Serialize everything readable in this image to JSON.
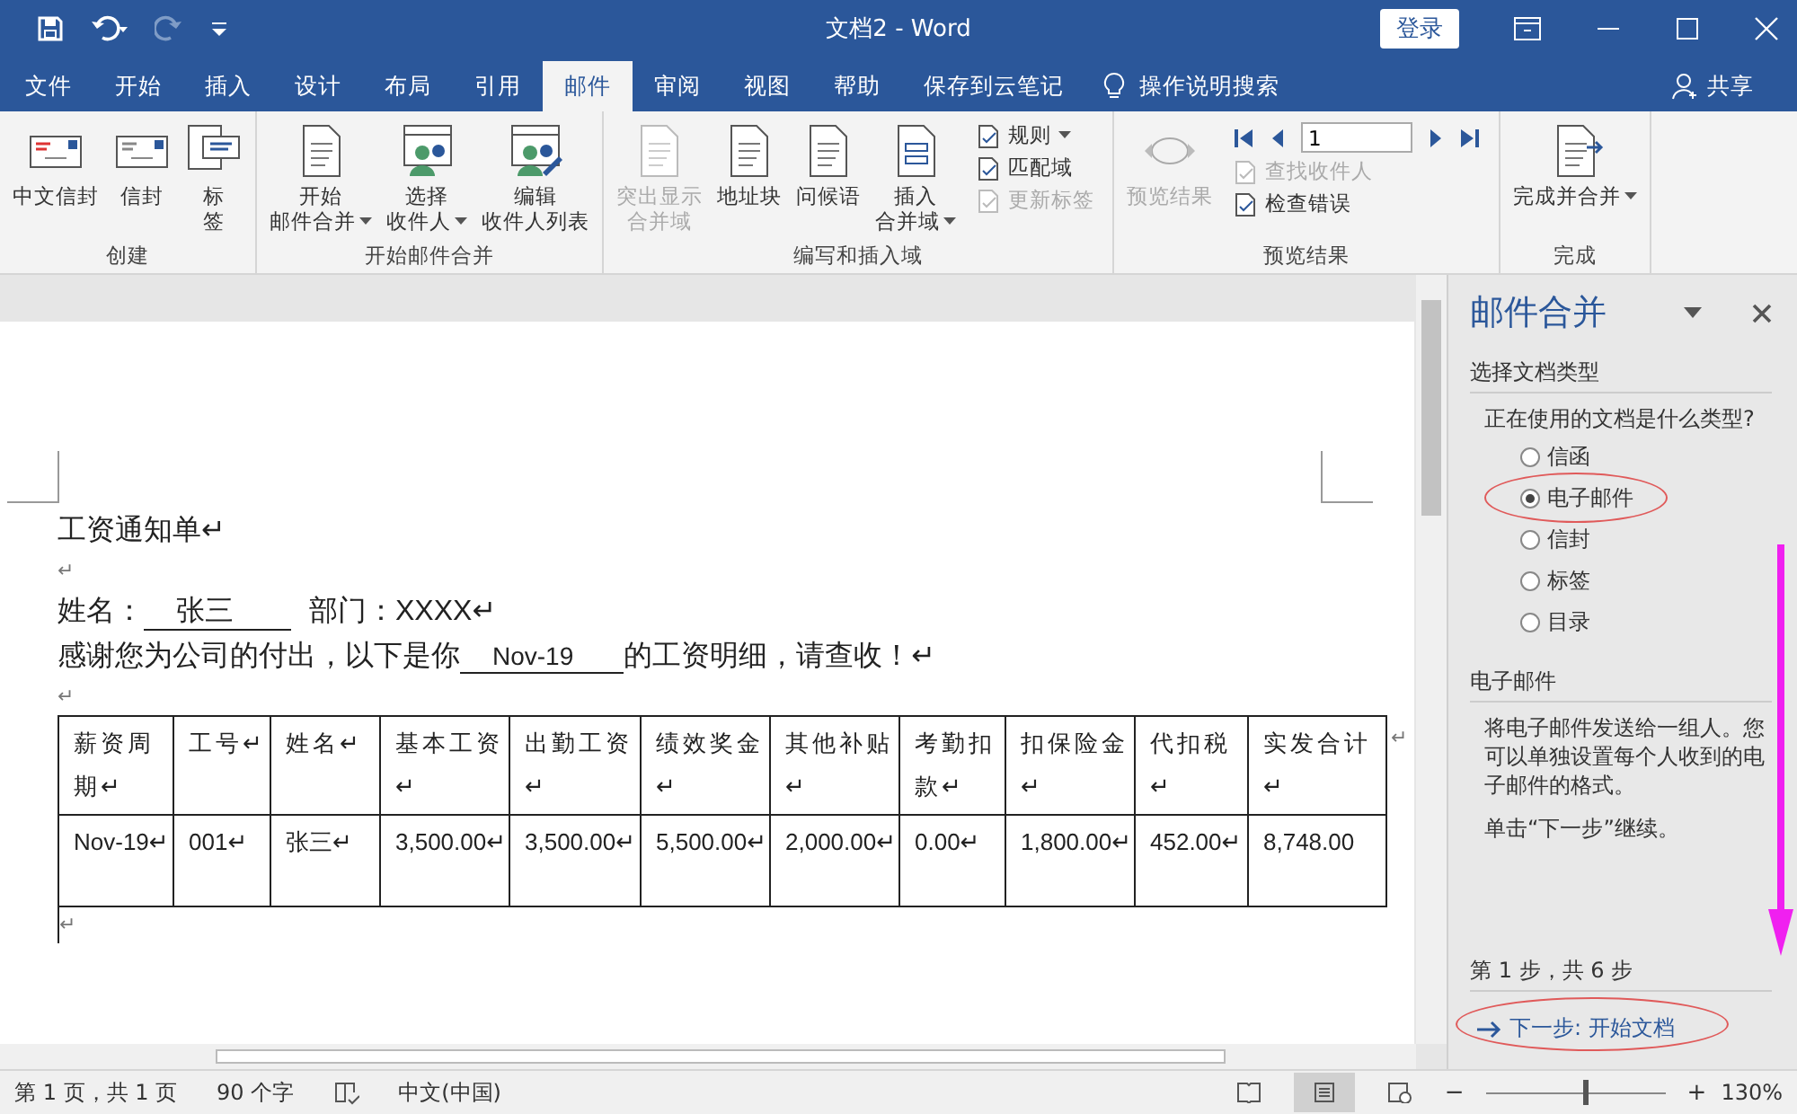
{
  "window": {
    "title": "文档2  -  Word",
    "login": "登录"
  },
  "tabs": [
    {
      "label": "文件",
      "selected": false
    },
    {
      "label": "开始",
      "selected": false
    },
    {
      "label": "插入",
      "selected": false
    },
    {
      "label": "设计",
      "selected": false
    },
    {
      "label": "布局",
      "selected": false
    },
    {
      "label": "引用",
      "selected": false
    },
    {
      "label": "邮件",
      "selected": true
    },
    {
      "label": "审阅",
      "selected": false
    },
    {
      "label": "视图",
      "selected": false
    },
    {
      "label": "帮助",
      "selected": false
    },
    {
      "label": "保存到云笔记",
      "selected": false
    }
  ],
  "tell_me": "操作说明搜索",
  "share": "共享",
  "ribbon": [
    {
      "label": "创建",
      "items": [
        {
          "kind": "large",
          "lines": [
            "中文信封"
          ],
          "disabled": false,
          "dropdown": false
        },
        {
          "kind": "large",
          "lines": [
            "信封"
          ],
          "disabled": false,
          "dropdown": false
        },
        {
          "kind": "large",
          "lines": [
            "标",
            "签"
          ],
          "disabled": false,
          "dropdown": false
        }
      ]
    },
    {
      "label": "开始邮件合并",
      "items": [
        {
          "kind": "large",
          "lines": [
            "开始",
            "邮件合并"
          ],
          "disabled": false,
          "dropdown": true
        },
        {
          "kind": "large",
          "lines": [
            "选择",
            "收件人"
          ],
          "disabled": false,
          "dropdown": true
        },
        {
          "kind": "large",
          "lines": [
            "编辑",
            "收件人列表"
          ],
          "disabled": false,
          "dropdown": false
        }
      ]
    },
    {
      "label": "编写和插入域",
      "items": [
        {
          "kind": "large",
          "lines": [
            "突出显示",
            "合并域"
          ],
          "disabled": true,
          "dropdown": false
        },
        {
          "kind": "large",
          "lines": [
            "地址块"
          ],
          "disabled": false,
          "dropdown": false
        },
        {
          "kind": "large",
          "lines": [
            "问候语"
          ],
          "disabled": false,
          "dropdown": false
        },
        {
          "kind": "large",
          "lines": [
            "插入",
            "合并域"
          ],
          "disabled": false,
          "dropdown": true
        },
        {
          "kind": "small",
          "lines": [
            "规则"
          ],
          "disabled": false,
          "dropdown": true
        },
        {
          "kind": "small",
          "lines": [
            "匹配域"
          ],
          "disabled": false,
          "dropdown": false
        },
        {
          "kind": "small",
          "lines": [
            "更新标签"
          ],
          "disabled": true,
          "dropdown": false
        }
      ]
    },
    {
      "label": "预览结果",
      "items": [
        {
          "kind": "large",
          "lines": [
            "预览结果"
          ],
          "disabled": true,
          "dropdown": false
        },
        {
          "kind": "nav",
          "value": "1"
        },
        {
          "kind": "small",
          "lines": [
            "查找收件人"
          ],
          "disabled": true,
          "dropdown": false
        },
        {
          "kind": "small",
          "lines": [
            "检查错误"
          ],
          "disabled": false,
          "dropdown": false
        }
      ]
    },
    {
      "label": "完成",
      "items": [
        {
          "kind": "large",
          "lines": [
            "完成并合并"
          ],
          "disabled": false,
          "dropdown": true
        }
      ]
    }
  ],
  "document": {
    "title": "工资通知单↵",
    "blank": "↵",
    "name_label": "姓名：",
    "name_value": "张三",
    "dept": "部门：XXXX↵",
    "thanks_before": "感谢您为公司的付出，以下是你",
    "thanks_value": "Nov-19",
    "thanks_after": "的工资明细，请查收！↵",
    "table": {
      "columns": [
        "薪资周期↵",
        "工号↵",
        "姓名↵",
        "基本工资↵",
        "出勤工资↵",
        "绩效奖金↵",
        "其他补贴↵",
        "考勤扣款↵",
        "扣保险金↵",
        "代扣税↵",
        "实发合计↵"
      ],
      "rows": [
        [
          "Nov-19↵",
          "001↵",
          "张三↵",
          "3,500.00↵",
          "3,500.00↵",
          "5,500.00↵",
          "2,000.00↵",
          "0.00↵",
          "1,800.00↵",
          "452.00↵",
          "8,748.00"
        ]
      ],
      "row_end": "↵"
    }
  },
  "task_pane": {
    "title": "邮件合并",
    "section1": "选择文档类型",
    "question": "正在使用的文档是什么类型?",
    "options": [
      {
        "label": "信函",
        "selected": false
      },
      {
        "label": "电子邮件",
        "selected": true
      },
      {
        "label": "信封",
        "selected": false
      },
      {
        "label": "标签",
        "selected": false
      },
      {
        "label": "目录",
        "selected": false
      }
    ],
    "section2": "电子邮件",
    "description": "将电子邮件发送给一组人。您可以单独设置每个人收到的电子邮件的格式。",
    "hint": "单击“下一步”继续。",
    "step": "第 1 步，共 6 步",
    "next": "下一步: 开始文档"
  },
  "status_bar": {
    "page": "第 1 页，共 1 页",
    "words": "90 个字",
    "language": "中文(中国)",
    "zoom": {
      "out": "−",
      "in": "+",
      "level": 0.55,
      "reading": "130%"
    },
    "views": [
      {
        "selected": false
      },
      {
        "selected": true
      },
      {
        "selected": false
      }
    ]
  }
}
